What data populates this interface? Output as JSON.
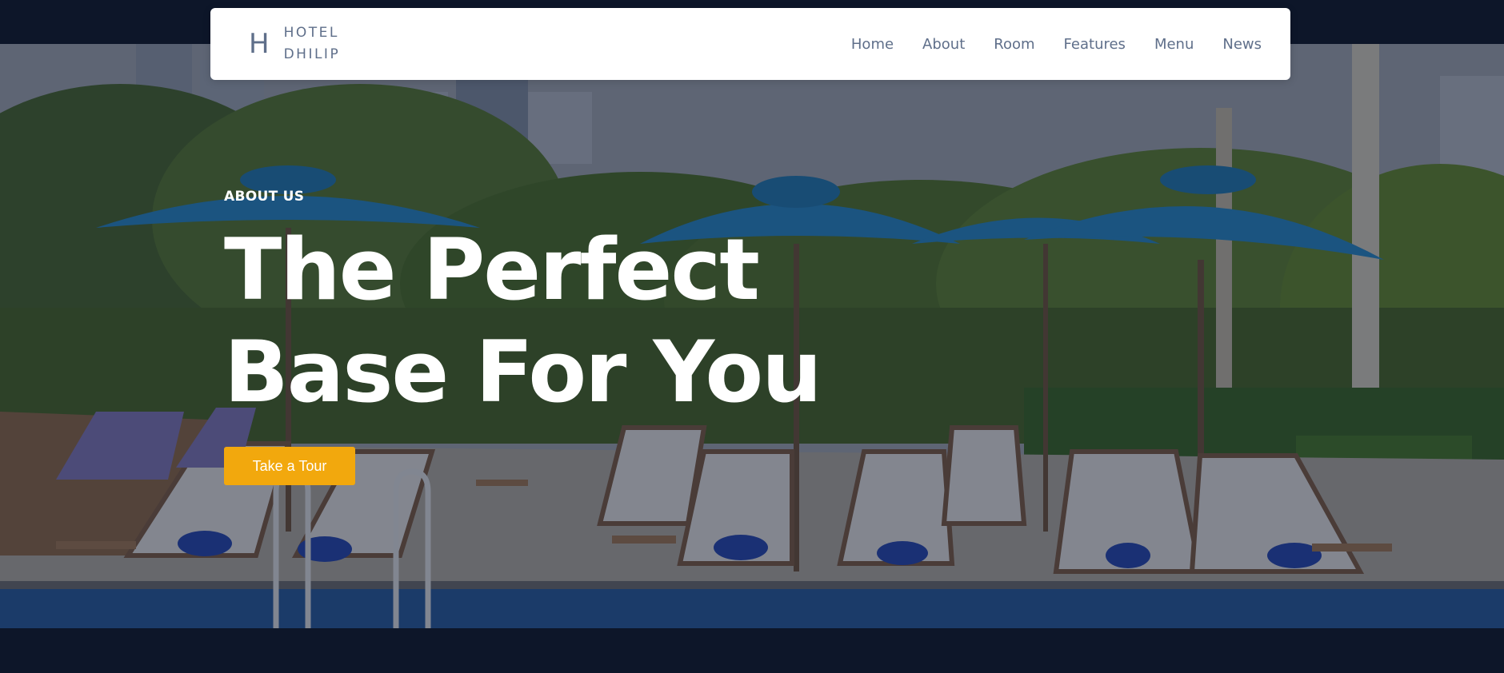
{
  "brand": {
    "mark": "H",
    "line1": "HOTEL",
    "line2": "DHILIP"
  },
  "nav": {
    "items": [
      "Home",
      "About",
      "Room",
      "Features",
      "Menu",
      "News"
    ]
  },
  "hero": {
    "eyebrow": "ABOUT US",
    "title_line1": "The Perfect",
    "title_line2": "Base For You",
    "cta_label": "Take a Tour",
    "background_image": "rooftop-pool-with-umbrellas-and-loungers"
  },
  "colors": {
    "page_bg": "#0d1629",
    "nav_text": "#5f6f8a",
    "accent": "#f2a80d",
    "hero_text": "#ffffff"
  }
}
